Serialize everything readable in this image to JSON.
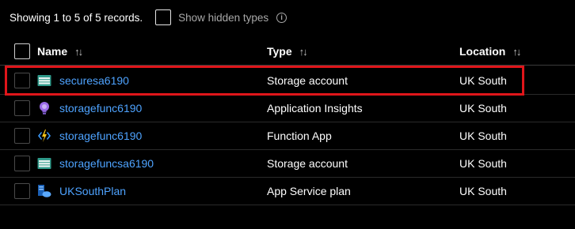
{
  "toolbar": {
    "records_text": "Showing 1 to 5 of 5 records.",
    "show_hidden_label": "Show hidden types"
  },
  "columns": {
    "name": "Name",
    "type": "Type",
    "location": "Location",
    "sort_glyph": "↑↓"
  },
  "rows": [
    {
      "name": "securesa6190",
      "type": "Storage account",
      "location": "UK South",
      "icon": "storage-account-icon"
    },
    {
      "name": "storagefunc6190",
      "type": "Application Insights",
      "location": "UK South",
      "icon": "application-insights-icon"
    },
    {
      "name": "storagefunc6190",
      "type": "Function App",
      "location": "UK South",
      "icon": "function-app-icon"
    },
    {
      "name": "storagefuncsa6190",
      "type": "Storage account",
      "location": "UK South",
      "icon": "storage-account-icon"
    },
    {
      "name": "UKSouthPlan",
      "type": "App Service plan",
      "location": "UK South",
      "icon": "app-service-plan-icon"
    }
  ],
  "colors": {
    "link": "#4ea3ff",
    "highlight": "#e0151a",
    "background": "#000000"
  }
}
